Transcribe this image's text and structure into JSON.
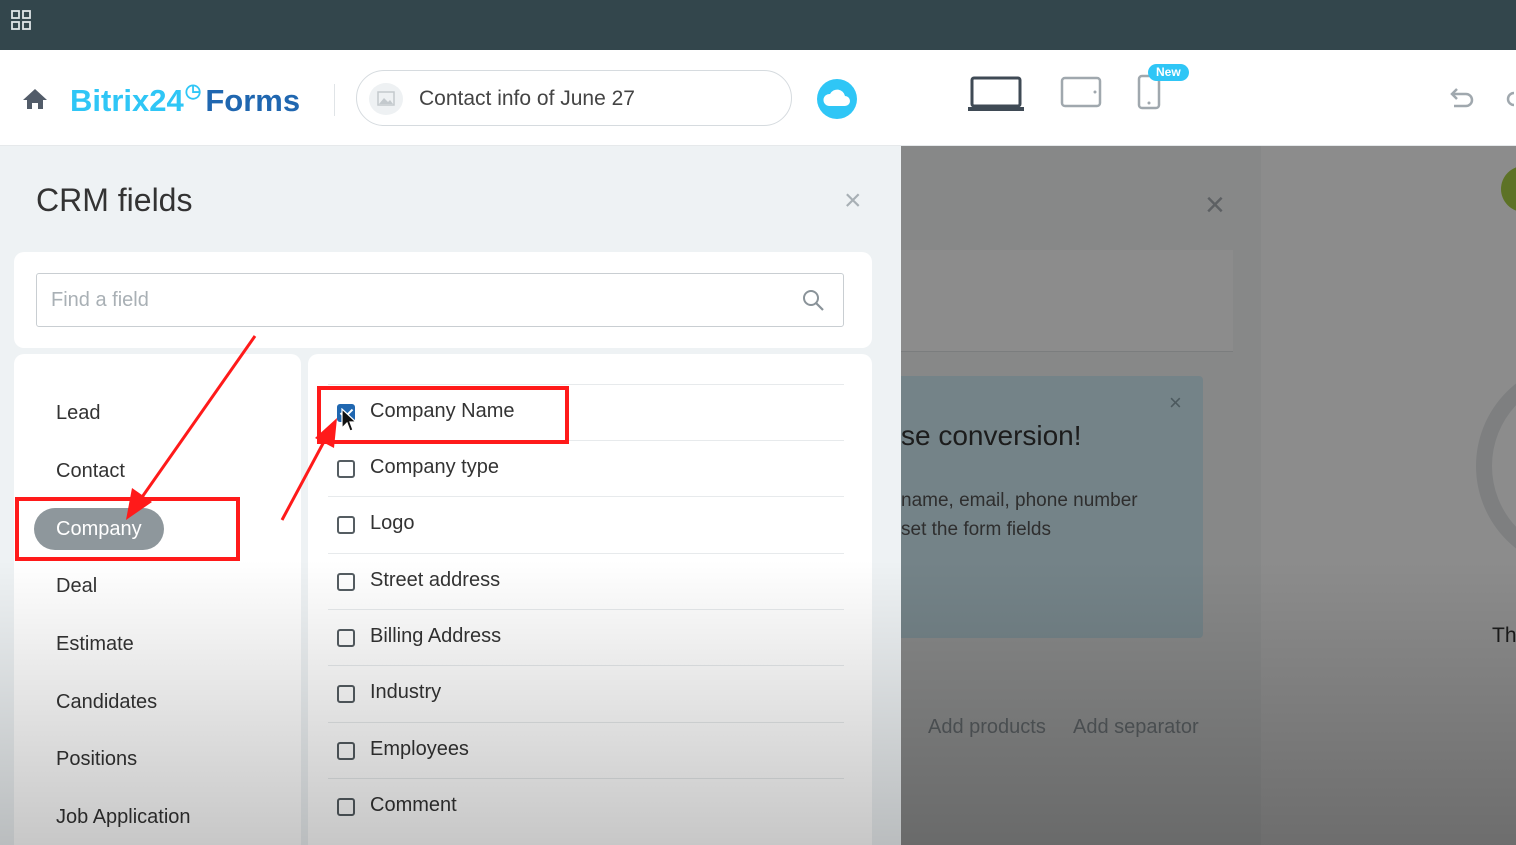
{
  "header": {
    "logo_brand": "Bitrix24",
    "logo_clock": "◷",
    "logo_product": "Forms",
    "form_title": "Contact info of June 27",
    "new_badge": "New"
  },
  "panel": {
    "title": "CRM fields",
    "close": "×",
    "search_placeholder": "Find a field",
    "categories": [
      {
        "label": "Lead",
        "active": false
      },
      {
        "label": "Contact",
        "active": false
      },
      {
        "label": "Company",
        "active": true
      },
      {
        "label": "Deal",
        "active": false
      },
      {
        "label": "Estimate",
        "active": false
      },
      {
        "label": "Candidates",
        "active": false
      },
      {
        "label": "Positions",
        "active": false
      },
      {
        "label": "Job Application",
        "active": false
      }
    ],
    "fields": [
      {
        "label": "Company Name",
        "checked": true
      },
      {
        "label": "Company type",
        "checked": false
      },
      {
        "label": "Logo",
        "checked": false
      },
      {
        "label": "Street address",
        "checked": false
      },
      {
        "label": "Billing Address",
        "checked": false
      },
      {
        "label": "Industry",
        "checked": false
      },
      {
        "label": "Employees",
        "checked": false
      },
      {
        "label": "Comment",
        "checked": false
      }
    ]
  },
  "background": {
    "close": "×",
    "hint_close": "×",
    "hint_title": "se conversion!",
    "hint_line1": "name, email, phone number",
    "hint_line2": "set the form fields",
    "add_products": "Add products",
    "add_separator": "Add separator",
    "right_text": "Th"
  },
  "colors": {
    "accent": "#2fc6f6",
    "brand_dark": "#2067b0",
    "annotation": "#ff1a1a",
    "topbar": "#33464c"
  }
}
